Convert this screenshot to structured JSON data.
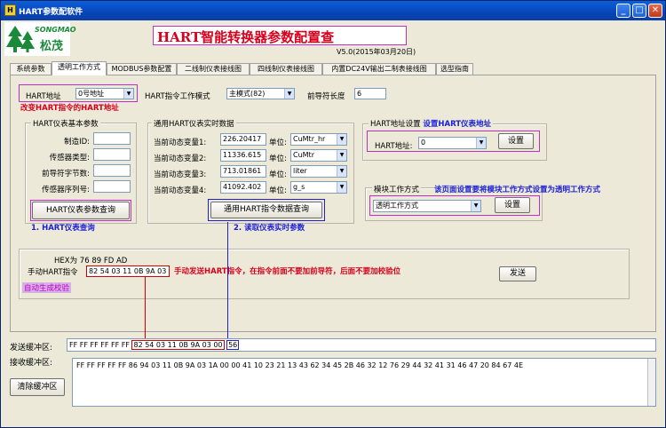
{
  "window": {
    "title": "HART参数配软件",
    "min": "_",
    "max": "□",
    "close": "✕"
  },
  "header": {
    "logo_text": "SONGMAO",
    "logo_cn": "松茂",
    "main_title": "HART智能转换器参数配置查",
    "version": "V5.0(2015年03月20日)"
  },
  "tabs": [
    {
      "label": "系统参数"
    },
    {
      "label": "透明工作方式",
      "active": true
    },
    {
      "label": "MODBUS参数配置"
    },
    {
      "label": "二线制仪表接线图"
    },
    {
      "label": "四线制仪表接线图"
    },
    {
      "label": "内置DC24V输出二制表接线图"
    },
    {
      "label": "选型指南"
    }
  ],
  "top_row": {
    "hart_addr_label": "HART地址",
    "hart_addr_value": "0号地址",
    "hart_addr_annot": "改变HART指令的HART地址",
    "cmd_mode_label": "HART指令工作模式",
    "cmd_mode_value": "主模式(82)",
    "preamble_label": "前导符长度",
    "preamble_value": "6"
  },
  "basic_params": {
    "title": "HART仪表基本参数",
    "fields": [
      {
        "label": "制造ID:",
        "value": ""
      },
      {
        "label": "传感器类型:",
        "value": ""
      },
      {
        "label": "前导符字节数:",
        "value": ""
      },
      {
        "label": "传感器序列号:",
        "value": ""
      }
    ],
    "query_button": "HART仪表参数查询",
    "annot": "1. HART仪表查询"
  },
  "realtime": {
    "title": "通用HART仪表实时数据",
    "rows": [
      {
        "label": "当前动态变量1:",
        "value": "226.20417",
        "unit_label": "单位:",
        "unit": "CuMtr_hr"
      },
      {
        "label": "当前动态变量2:",
        "value": "11336.615",
        "unit_label": "单位:",
        "unit": "CuMtr"
      },
      {
        "label": "当前动态变量3:",
        "value": "713.01861",
        "unit_label": "单位:",
        "unit": "liter"
      },
      {
        "label": "当前动态变量4:",
        "value": "41092.402",
        "unit_label": "单位:",
        "unit": "g_s"
      }
    ],
    "query_button": "通用HART指令数据查询",
    "annot": "2. 读取仪表实时参数"
  },
  "addr_setting": {
    "title": "HART地址设置",
    "title_annot": "设置HART仪表地址",
    "addr_label": "HART地址:",
    "addr_value": "0",
    "set_button": "设置"
  },
  "module_mode": {
    "title": "模块工作方式",
    "annot": "该页面设置要将模块工作方式设置为透明工作方式",
    "value": "透明工作方式",
    "set_button": "设置"
  },
  "manual": {
    "hex_label": "HEX为",
    "hex_value": "76 89 FD AD",
    "cmd_label": "手动HART指令",
    "cmd_value": "82 54 03 11 0B 9A 03 00",
    "annot": "手动发送HART指令，在指令前面不要加前导符，后面不要加校验位",
    "auto_check": "自动生成校验",
    "send_button": "发送"
  },
  "buffers": {
    "send_label": "发送缓冲区:",
    "send_prefix": "FF FF FF FF FF FF",
    "send_mid": "82 54 03 11 0B 9A 03 00",
    "send_suffix": "56",
    "recv_label": "接收缓冲区:",
    "recv_value": "FF FF FF FF FF 86 94 03 11 0B 9A 03 1A 00 00 41 10 23 21 13 43 62 34 45 2B 46 32 12 76 29 44 32 41 31 46 47 20 84 67 4E",
    "clear_button": "清除缓冲区"
  },
  "colors": {
    "annot_red": "#d8001c",
    "annot_blue": "#1c20d8",
    "titlebar": "#0844b8",
    "highlight_magenta": "#c030c0"
  }
}
